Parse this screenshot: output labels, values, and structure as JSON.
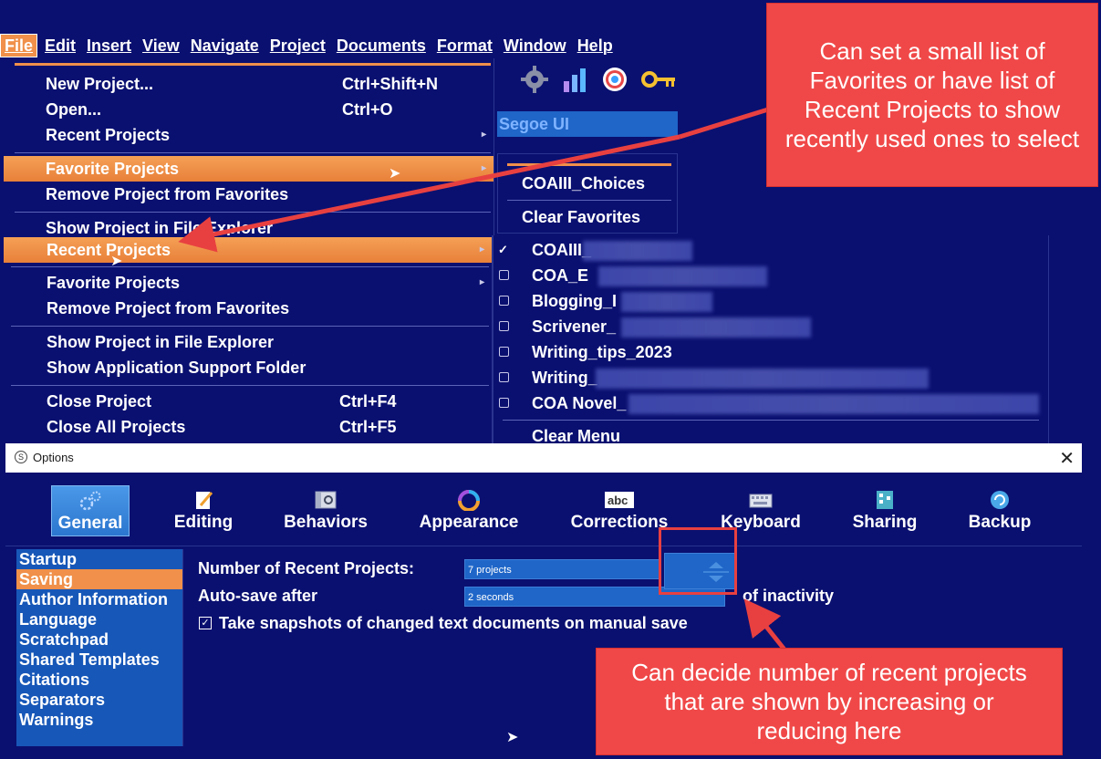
{
  "menubar": {
    "items": [
      "File",
      "Edit",
      "Insert",
      "View",
      "Navigate",
      "Project",
      "Documents",
      "Format",
      "Window",
      "Help"
    ]
  },
  "toolbar": {
    "font_name": "Segoe UI"
  },
  "file_menu_upper": {
    "items": [
      {
        "label": "New Project...",
        "shortcut": "Ctrl+Shift+N"
      },
      {
        "label": "Open...",
        "shortcut": "Ctrl+O"
      },
      {
        "label": "Recent Projects"
      },
      {
        "label": "Favorite Projects"
      },
      {
        "label": "Remove Project from Favorites"
      },
      {
        "label": "Show Project in File Explorer"
      }
    ]
  },
  "favorites_submenu": {
    "items": [
      "COAIII_Choices",
      "Clear Favorites"
    ]
  },
  "file_menu_lower": {
    "items": [
      {
        "label": "Recent Projects"
      },
      {
        "label": "Favorite Projects"
      },
      {
        "label": "Remove Project from Favorites"
      },
      {
        "label": "Show Project in File Explorer"
      },
      {
        "label": "Show Application Support Folder"
      },
      {
        "label": "Close Project",
        "shortcut": "Ctrl+F4"
      },
      {
        "label": "Close All Projects",
        "shortcut": "Ctrl+F5"
      }
    ]
  },
  "recent_submenu": {
    "items": [
      {
        "label": "COAIII_",
        "checked": true
      },
      {
        "label": "COA_E",
        "checked": false
      },
      {
        "label": "Blogging_I",
        "checked": false
      },
      {
        "label": "Scrivener_",
        "checked": false
      },
      {
        "label": "Writing_tips_2023",
        "checked": false
      },
      {
        "label": "Writing_",
        "checked": false
      },
      {
        "label": "COA Novel_",
        "checked": false
      }
    ],
    "clear_label": "Clear Menu"
  },
  "options_window": {
    "title": "Options",
    "tabs": [
      "General",
      "Editing",
      "Behaviors",
      "Appearance",
      "Corrections",
      "Keyboard",
      "Sharing",
      "Backup"
    ],
    "sidebar": [
      "Startup",
      "Saving",
      "Author Information",
      "Language",
      "Scratchpad",
      "Shared Templates",
      "Citations",
      "Separators",
      "Warnings"
    ],
    "recent_label": "Number of Recent Projects:",
    "recent_value": "7 projects",
    "autosave_label": "Auto-save after",
    "autosave_value": "2 seconds",
    "autosave_suffix": "of inactivity",
    "snapshot_label": "Take snapshots of changed text documents on manual save"
  },
  "callouts": {
    "top": "Can set a small list of Favorites or have list of Recent Projects to show recently used ones to select",
    "bottom": "Can decide number of recent projects that are shown by increasing or reducing here"
  },
  "colors": {
    "background": "#0a1070",
    "highlight": "#f0904a",
    "field": "#1f66c8",
    "callout": "#f04848"
  }
}
